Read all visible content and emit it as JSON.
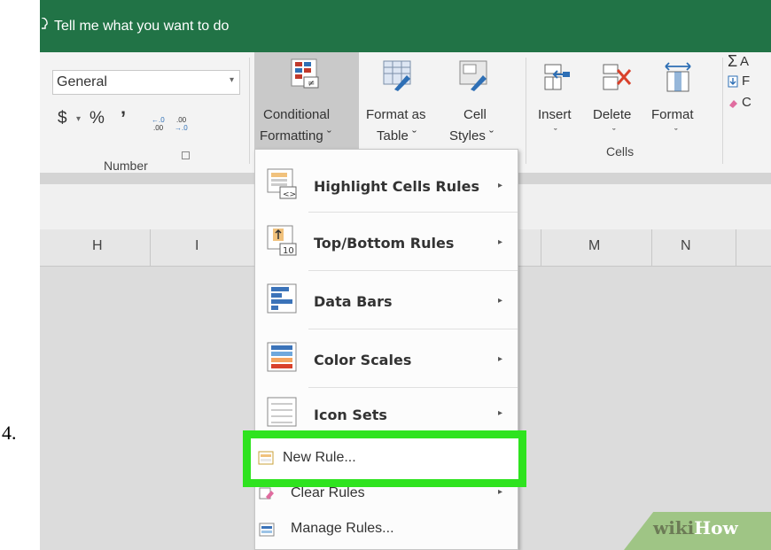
{
  "step_number": "4.",
  "tell_me": "Tell me what you want to do",
  "ribbon": {
    "number_format_value": "General",
    "currency_symbol": "$",
    "dropdown_caret": "▾",
    "percent_symbol": "%",
    "comma_symbol": "’",
    "increase_decimal": "+.0\n.00",
    "decrease_decimal": ".00\n→.0",
    "number_group_label": "Number",
    "conditional_formatting_line1": "Conditional",
    "conditional_formatting_line2": "Formatting ˇ",
    "format_as_table_line1": "Format as",
    "format_as_table_line2": "Table ˇ",
    "cell_styles_line1": "Cell",
    "cell_styles_line2": "Styles ˇ",
    "insert_label": "Insert",
    "delete_label": "Delete",
    "format_label": "Format",
    "caret": "ˇ",
    "cells_group_label": "Cells",
    "autosum_partial": "A",
    "fill_partial": "F",
    "clear_partial": "C"
  },
  "columns": {
    "h": "H",
    "i": "I",
    "m": "M",
    "n": "N"
  },
  "menu": {
    "items": [
      {
        "label": "Highlight Cells Rules",
        "icon": "highlight-cells-icon"
      },
      {
        "label": "Top/Bottom Rules",
        "icon": "top-bottom-icon"
      },
      {
        "label": "Data Bars",
        "icon": "data-bars-icon"
      },
      {
        "label": "Color Scales",
        "icon": "color-scales-icon"
      },
      {
        "label": "Icon Sets",
        "icon": "icon-sets-icon"
      }
    ],
    "submenu_arrow": "▸",
    "new_rule": "New Rule...",
    "clear_rules": "Clear Rules",
    "manage_rules": "Manage Rules..."
  },
  "watermark": {
    "part1": "wiki",
    "part2": "How"
  },
  "colors": {
    "excel_green": "#217346",
    "highlight_green": "#2fe31f",
    "watermark_green": "#9fc585"
  }
}
